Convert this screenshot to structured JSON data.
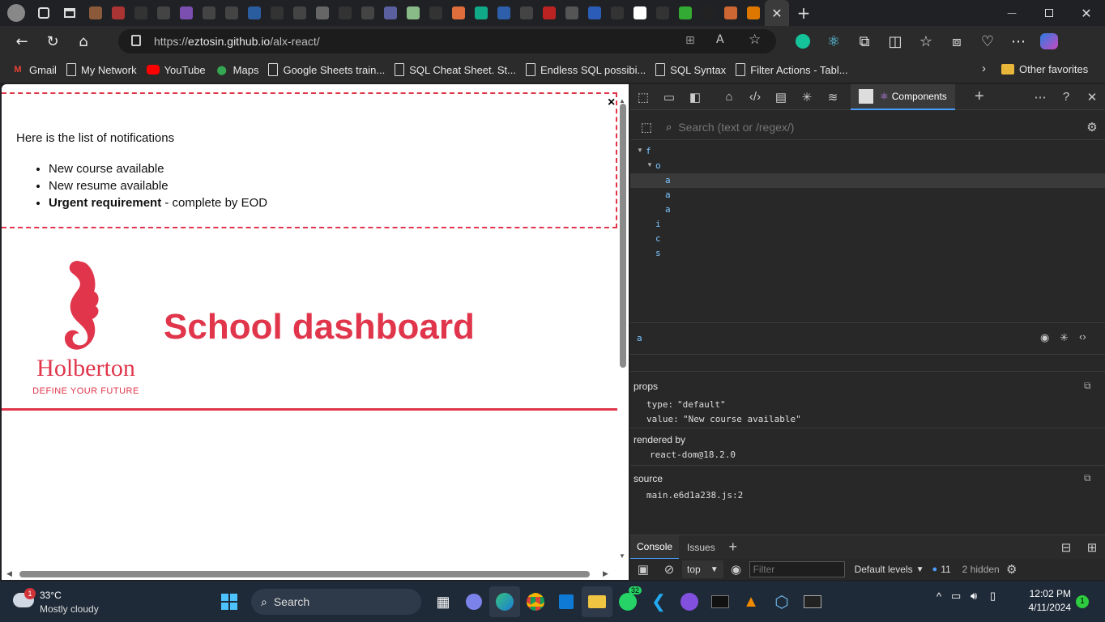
{
  "browser": {
    "tabs_count_visible": 38,
    "url_prefix": "https://",
    "url_domain": "eztosin.github.io",
    "url_path": "/alx-react/"
  },
  "bookmarks": [
    {
      "label": "Gmail",
      "icon": "gmail-icon"
    },
    {
      "label": "My Network",
      "icon": "page-icon"
    },
    {
      "label": "YouTube",
      "icon": "youtube-icon"
    },
    {
      "label": "Maps",
      "icon": "maps-icon"
    },
    {
      "label": "Google Sheets train...",
      "icon": "page-icon"
    },
    {
      "label": "SQL Cheat Sheet. St...",
      "icon": "page-icon"
    },
    {
      "label": "Endless SQL possibi...",
      "icon": "page-icon"
    },
    {
      "label": "SQL Syntax",
      "icon": "page-icon"
    },
    {
      "label": "Filter Actions - Tabl...",
      "icon": "page-icon"
    }
  ],
  "bookmarks_other": "Other favorites",
  "notifications": {
    "title": "Here is the list of notifications",
    "items": [
      {
        "text": "New course available"
      },
      {
        "text": "New resume available"
      },
      {
        "bold": "Urgent requirement",
        "text": " - complete by EOD"
      }
    ],
    "close": "×"
  },
  "app": {
    "title": "School dashboard",
    "logo_text": "Holberton",
    "logo_tagline": "DEFINE YOUR FUTURE"
  },
  "devtools": {
    "active_tab": "Components",
    "search_placeholder": "Search (text or /regex/)",
    "tree": [
      {
        "label": "f",
        "depth": 0,
        "expanded": true
      },
      {
        "label": "o",
        "depth": 1,
        "expanded": true
      },
      {
        "label": "a",
        "depth": 2,
        "selected": true
      },
      {
        "label": "a",
        "depth": 2
      },
      {
        "label": "a",
        "depth": 2
      },
      {
        "label": "i",
        "depth": 1
      },
      {
        "label": "c",
        "depth": 1
      },
      {
        "label": "s",
        "depth": 1
      }
    ],
    "selected": "a",
    "props_label": "props",
    "props": [
      {
        "key": "type:",
        "value": "\"default\""
      },
      {
        "key": "value:",
        "value": "\"New course available\""
      }
    ],
    "rendered_by_label": "rendered by",
    "rendered_by": "react-dom@18.2.0",
    "source_label": "source",
    "source": "main.e6d1a238.js:2",
    "drawer_tabs": [
      "Console",
      "Issues"
    ],
    "context": "top",
    "filter_placeholder": "Filter",
    "levels": "Default levels",
    "issues_count": "11",
    "hidden": "2 hidden"
  },
  "taskbar": {
    "weather_temp": "33°C",
    "weather_desc": "Mostly cloudy",
    "weather_badge": "1",
    "search": "Search",
    "whatsapp_badge": "32",
    "time": "12:02 PM",
    "date": "4/11/2024",
    "notif_badge": "1"
  },
  "colors": {
    "accent": "#e0354b",
    "devtools_bg": "#282828",
    "tree_blue": "#7cc5ff"
  }
}
